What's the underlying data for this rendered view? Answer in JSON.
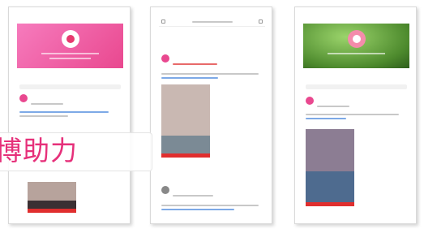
{
  "overlay": {
    "text": "博助力"
  },
  "phones": {
    "left": {
      "tabs": [
        "",
        "",
        ""
      ]
    },
    "middle": {
      "tabs": [
        "",
        "",
        ""
      ]
    },
    "right": {
      "tabs": [
        "",
        "",
        ""
      ]
    }
  },
  "colors": {
    "accent": "#e6307a",
    "pink_cover": "#f67bbd",
    "green_cover": "#4d8a2d"
  }
}
